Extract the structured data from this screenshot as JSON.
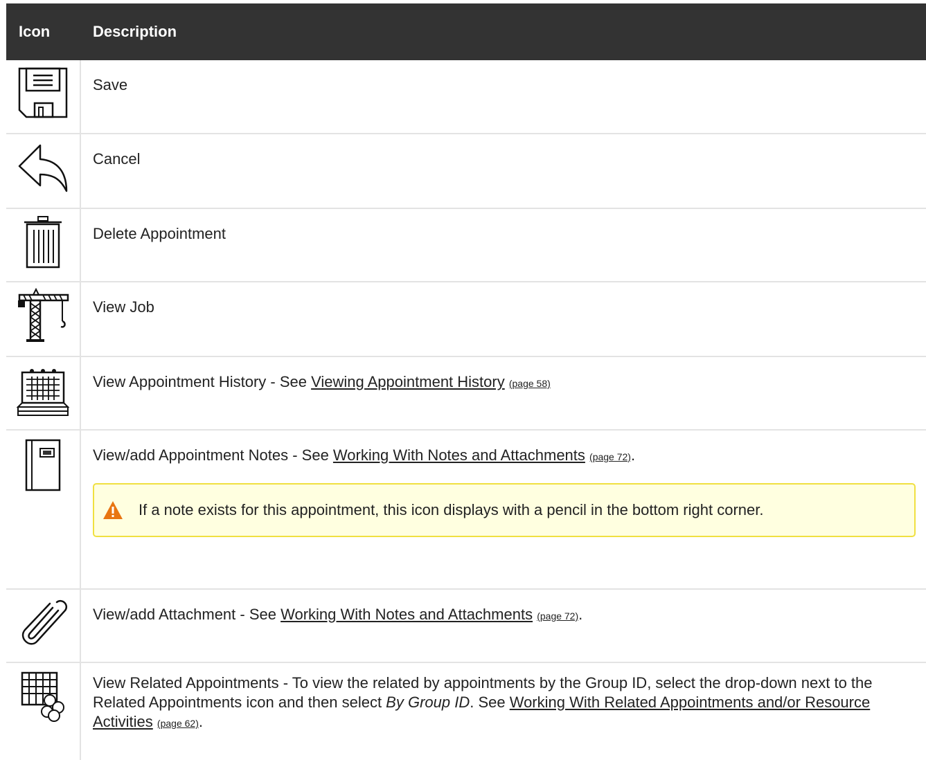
{
  "header": {
    "col_icon": "Icon",
    "col_description": "Description"
  },
  "rows": [
    {
      "icon": "save-icon",
      "text": "Save"
    },
    {
      "icon": "cancel-undo-icon",
      "text": "Cancel"
    },
    {
      "icon": "trash-icon",
      "text": "Delete Appointment"
    },
    {
      "icon": "crane-icon",
      "text": "View Job"
    },
    {
      "icon": "calendar-history-icon",
      "text": "View Appointment History - See ",
      "link": "Viewing Appointment History",
      "page": "(page 58)"
    },
    {
      "icon": "notebook-icon",
      "text": "View/add Appointment Notes - See ",
      "link": "Working With Notes and Attachments",
      "page": "(page 72)",
      "after": ".",
      "note": "If a note exists for this appointment, this icon displays with a pencil in the bottom right corner."
    },
    {
      "icon": "paperclip-icon",
      "text": "View/add Attachment - See ",
      "link": "Working With Notes and Attachments",
      "page": "(page 72)",
      "after": "."
    },
    {
      "icon": "related-appointments-icon",
      "text": "View Related Appointments - To view the related by appointments by the Group ID, select the drop-down next to the Related Appointments icon and then select ",
      "italic": "By Group ID",
      "text2": ". See ",
      "link": "Working With Related Appointments and/or Resource Activities",
      "page": "(page 62)",
      "after": "."
    }
  ],
  "colors": {
    "header_bg": "#333333",
    "note_bg": "#ffffe0",
    "note_border": "#f0e040",
    "warning": "#e87511"
  }
}
